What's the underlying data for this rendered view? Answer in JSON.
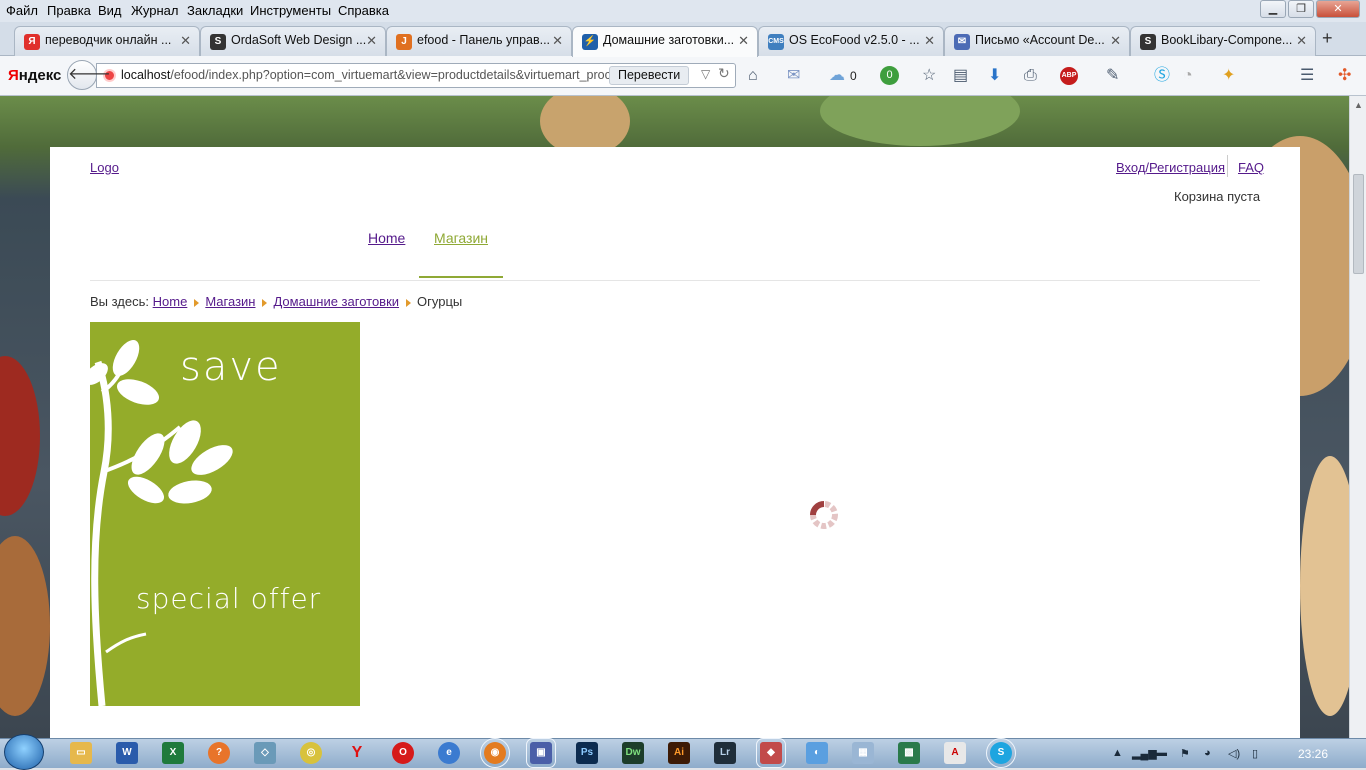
{
  "menu": [
    "Файл",
    "Правка",
    "Вид",
    "Журнал",
    "Закладки",
    "Инструменты",
    "Справка"
  ],
  "tabs": [
    {
      "title": "переводчик онлайн ...",
      "icon": "Я",
      "icon_color": "#e0302c"
    },
    {
      "title": "OrdaSoft Web Design ...",
      "icon": "S",
      "icon_color": "#333333"
    },
    {
      "title": "efood - Панель управ...",
      "icon": "J",
      "icon_color": "#e07020"
    },
    {
      "title": "Домашние заготовки...",
      "icon": "⚡",
      "icon_color": "#1f5faa"
    },
    {
      "title": "OS EcoFood v2.5.0 - ...",
      "icon": "CMS",
      "icon_color": "#3f7fbf"
    },
    {
      "title": "Письмо «Account De...",
      "icon": "✉",
      "icon_color": "#4c6bb5"
    },
    {
      "title": "BookLibary-Compone...",
      "icon": "S",
      "icon_color": "#333333"
    }
  ],
  "browser": {
    "brand_first": "Я",
    "brand_rest": "ндекс",
    "url_host": "localhost",
    "url_path": "/efood/index.php?option=com_virtuemart&view=productdetails&virtuemart_proc",
    "translate_label": "Перевести",
    "cloud_count": "0",
    "badge_count": "0"
  },
  "site": {
    "logo": "Logo",
    "login": "Вход/Регистрация",
    "faq": "FAQ",
    "cart": "Корзина пуста",
    "nav": {
      "home": "Home",
      "shop": "Магазин"
    },
    "breadcrumb": {
      "prefix": "Вы здесь:",
      "items": [
        "Home",
        "Магазин",
        "Домашние заготовки"
      ],
      "current": "Огурцы"
    },
    "promo": {
      "line1": "save",
      "line2": "special offer",
      "bg_color": "#94ac2a"
    }
  },
  "taskbar": {
    "clock": "23:26"
  }
}
